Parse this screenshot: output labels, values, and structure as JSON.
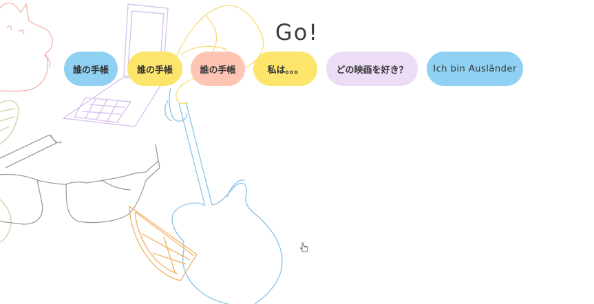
{
  "heading": {
    "text": "Go!"
  },
  "buttons": [
    {
      "label": "誰の手帳",
      "color": "#8fd0f3"
    },
    {
      "label": "誰の手帳",
      "color": "#fde46b"
    },
    {
      "label": "誰の手帳",
      "color": "#fec4b4"
    },
    {
      "label": "私は。。。",
      "color": "#fde46b"
    },
    {
      "label": "どの映画を好き？",
      "color": "#ecdcf6"
    },
    {
      "label": "Ich bin Ausländer",
      "color": "#8fd0f3"
    }
  ],
  "illustrations": [
    "cat-doodle",
    "flip-phone-doodle",
    "sunglasses-doodle",
    "guitar-doodle",
    "orange-slice-doodle",
    "leaf-doodle"
  ],
  "colors": {
    "blue": "#8fd0f3",
    "yellow": "#fde46b",
    "peach": "#fec4b4",
    "lavender": "#ecdcf6",
    "text": "#333333"
  }
}
